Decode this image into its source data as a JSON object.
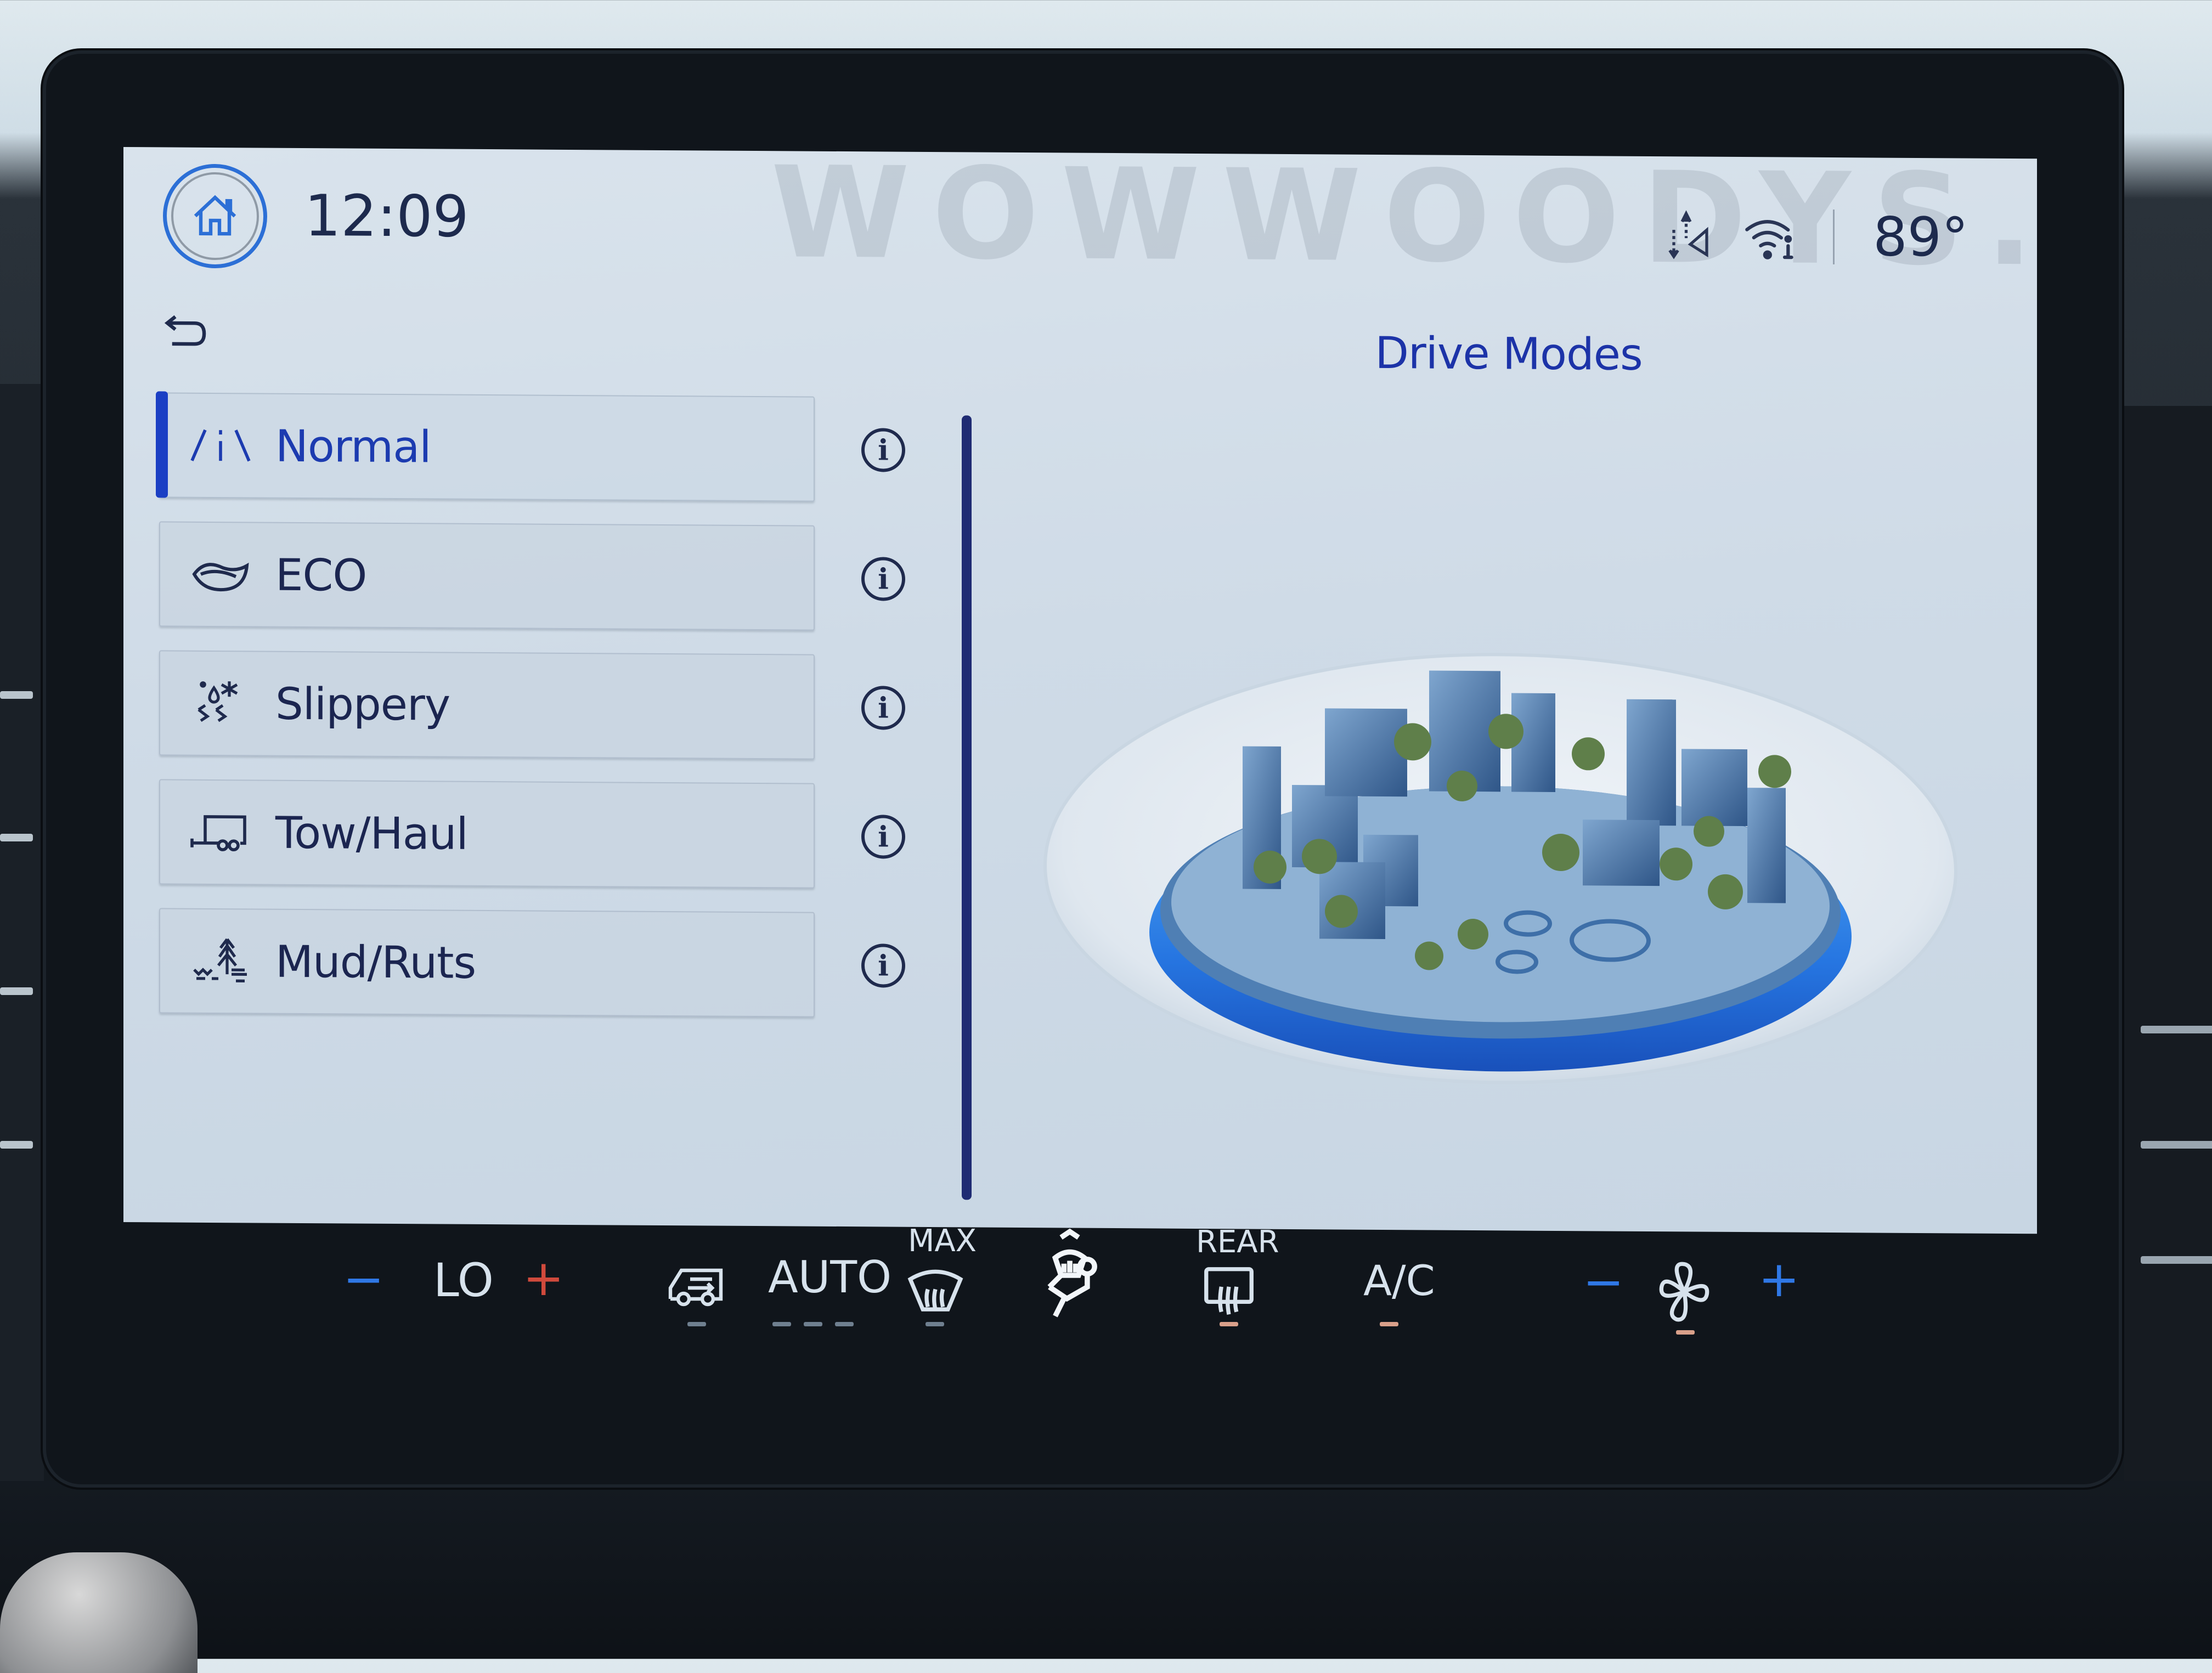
{
  "status_bar": {
    "clock": "12:09",
    "outside_temp": "89°",
    "icons": [
      "home-icon",
      "navigation-data-icon",
      "wifi-info-icon"
    ]
  },
  "nav": {
    "back_icon": "back-arrow-icon"
  },
  "drive_modes": {
    "title": "Drive Modes",
    "selected": "Normal",
    "accent_color": "#1b3fc4",
    "items": [
      {
        "label": "Normal",
        "icon": "road-icon",
        "selected": true
      },
      {
        "label": "ECO",
        "icon": "leaf-icon",
        "selected": false
      },
      {
        "label": "Slippery",
        "icon": "slippery-icon",
        "selected": false
      },
      {
        "label": "Tow/Haul",
        "icon": "trailer-icon",
        "selected": false
      },
      {
        "label": "Mud/Ruts",
        "icon": "mud-ruts-icon",
        "selected": false
      }
    ],
    "info_icon": "info-icon",
    "illustration": "city-platform-illustration"
  },
  "climate": {
    "temp_minus": "−",
    "temp_value": "LO",
    "temp_plus": "+",
    "recirc_icon": "recirculation-icon",
    "auto_label": "AUTO",
    "max_label": "MAX",
    "max_defrost_icon": "front-defrost-icon",
    "seat_icon": "climate-seat-icon",
    "rear_label": "REAR",
    "rear_defrost_icon": "rear-defrost-icon",
    "ac_label": "A/C",
    "fan_minus": "−",
    "fan_icon": "fan-icon",
    "fan_plus": "+",
    "colors": {
      "cool": "#2f78e6",
      "warm": "#d04a3c",
      "active_indicator": "#d9a08a",
      "inactive_indicator": "#6f7f8f"
    }
  }
}
